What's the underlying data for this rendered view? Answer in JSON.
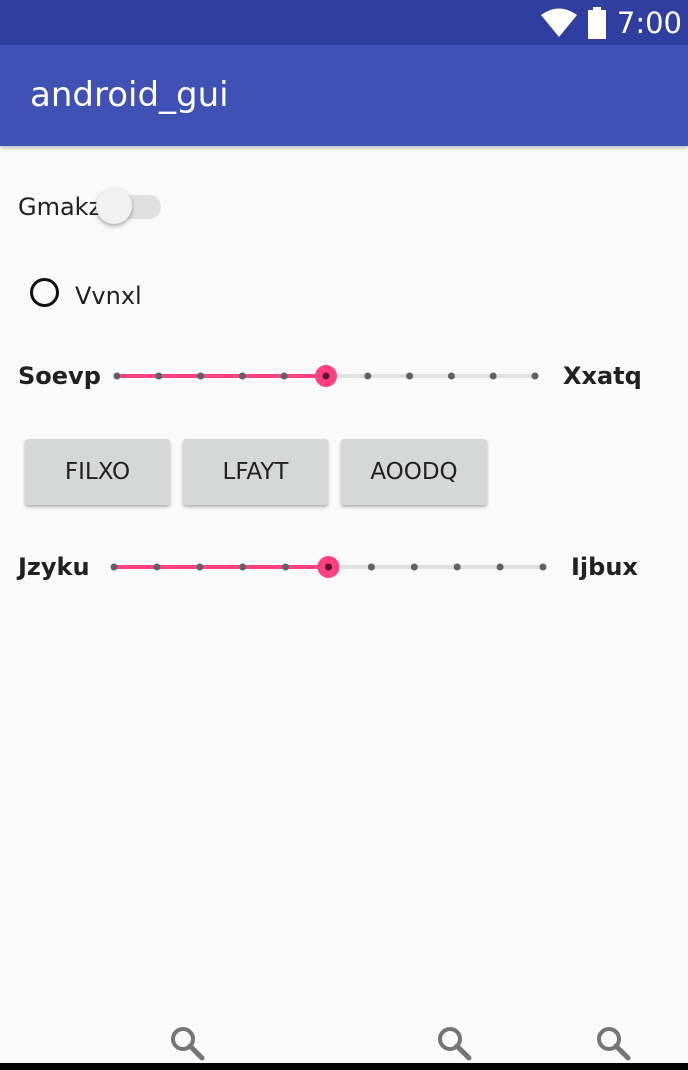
{
  "status_bar": {
    "time": "7:00",
    "icons": [
      "wifi-icon",
      "battery-icon"
    ]
  },
  "app_bar": {
    "title": "android_gui"
  },
  "switch": {
    "label": "Gmakz",
    "checked": false
  },
  "radio": {
    "label": "Vvnxl",
    "checked": false
  },
  "slider1": {
    "left_label": "Soevp",
    "right_label": "Xxatq",
    "value": 5,
    "max": 10
  },
  "buttons": [
    {
      "label": "FILXO"
    },
    {
      "label": "LFAYT"
    },
    {
      "label": "AOODQ"
    }
  ],
  "slider2": {
    "left_label": "Jzyku",
    "right_label": "Ijbux",
    "value": 5,
    "max": 10
  },
  "bottom_nav": {
    "icons": [
      "search-icon",
      "search-icon",
      "search-icon"
    ]
  },
  "colors": {
    "primary": "#3f51b5",
    "primary_dark": "#303f9f",
    "accent": "#ff4081"
  }
}
